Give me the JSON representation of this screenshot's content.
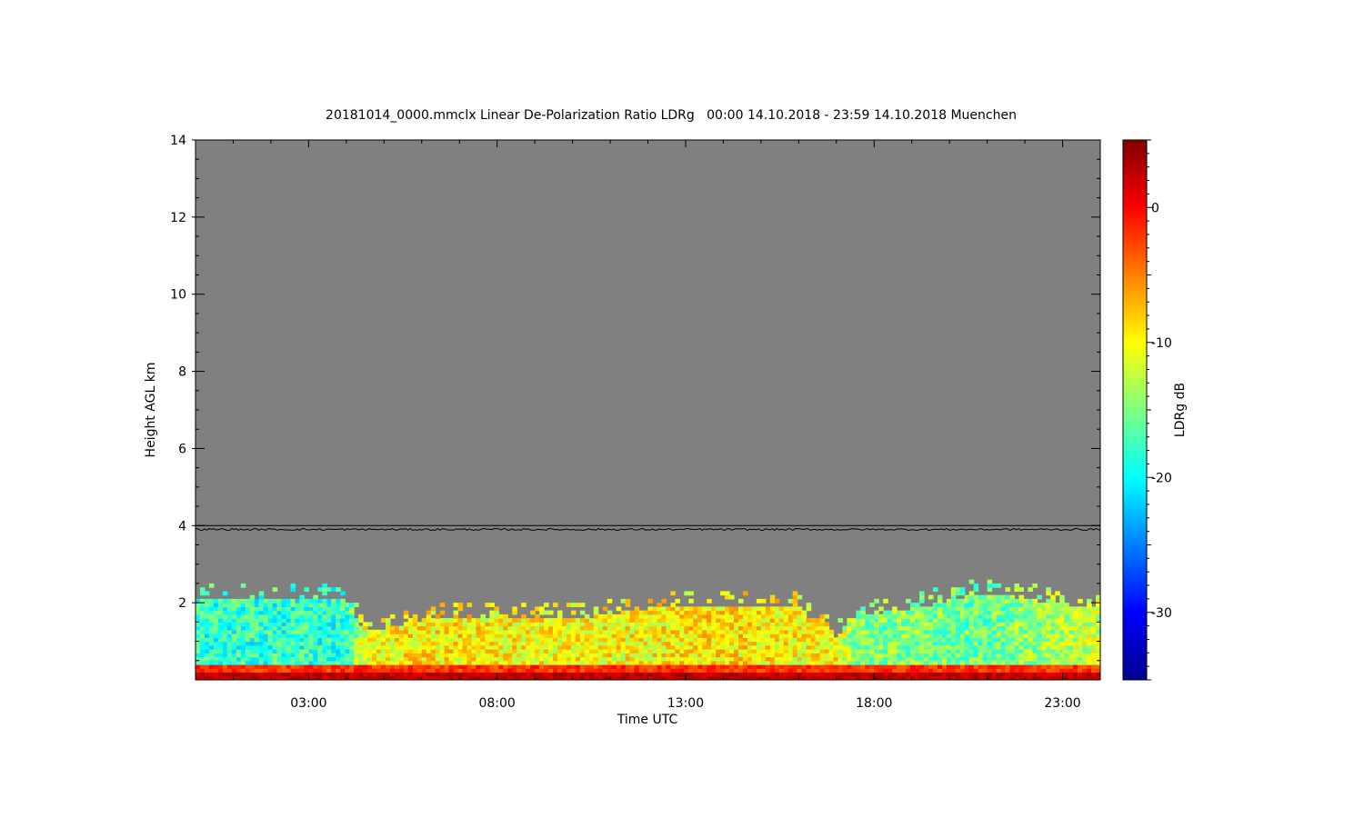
{
  "chart_data": {
    "type": "heatmap",
    "title": "20181014_0000.mmclx Linear De-Polarization Ratio LDRg   00:00 14.10.2018 - 23:59 14.10.2018 Muenchen",
    "xlabel": "Time UTC",
    "ylabel": "Height AGL km",
    "colorbar_label": "LDRg dB",
    "x_range_hours": [
      0,
      24
    ],
    "ylim": [
      0,
      14
    ],
    "x_ticks": [
      "03:00",
      "08:00",
      "13:00",
      "18:00",
      "23:00"
    ],
    "x_tick_hours": [
      3,
      8,
      13,
      18,
      23
    ],
    "y_ticks": [
      "2",
      "4",
      "6",
      "8",
      "10",
      "12",
      "14"
    ],
    "y_tick_values": [
      2,
      4,
      6,
      8,
      10,
      12,
      14
    ],
    "colorbar_range": [
      -35,
      5
    ],
    "colorbar_ticks": [
      "0",
      "-10",
      "-20",
      "-30"
    ],
    "colorbar_tick_values": [
      0,
      -10,
      -20,
      -30
    ],
    "colormap": "jet",
    "no_data_color": "#808080",
    "line_series": {
      "name": "",
      "height_km": 3.9,
      "color": "#000000"
    },
    "echo_profile": {
      "hours": [
        0,
        2,
        4,
        4.5,
        6,
        8,
        10,
        12,
        14,
        16,
        17,
        17.5,
        19,
        21,
        23,
        24
      ],
      "echo_top_km": [
        2.0,
        2.1,
        2.0,
        1.2,
        1.5,
        1.6,
        1.5,
        1.8,
        1.9,
        1.8,
        1.0,
        1.6,
        1.8,
        2.2,
        1.9,
        1.8
      ],
      "ldr_db": [
        -18,
        -18,
        -18,
        -11,
        -9,
        -10,
        -10,
        -10,
        -9,
        -10,
        -10,
        -15,
        -15,
        -16,
        -13,
        -12
      ]
    }
  }
}
